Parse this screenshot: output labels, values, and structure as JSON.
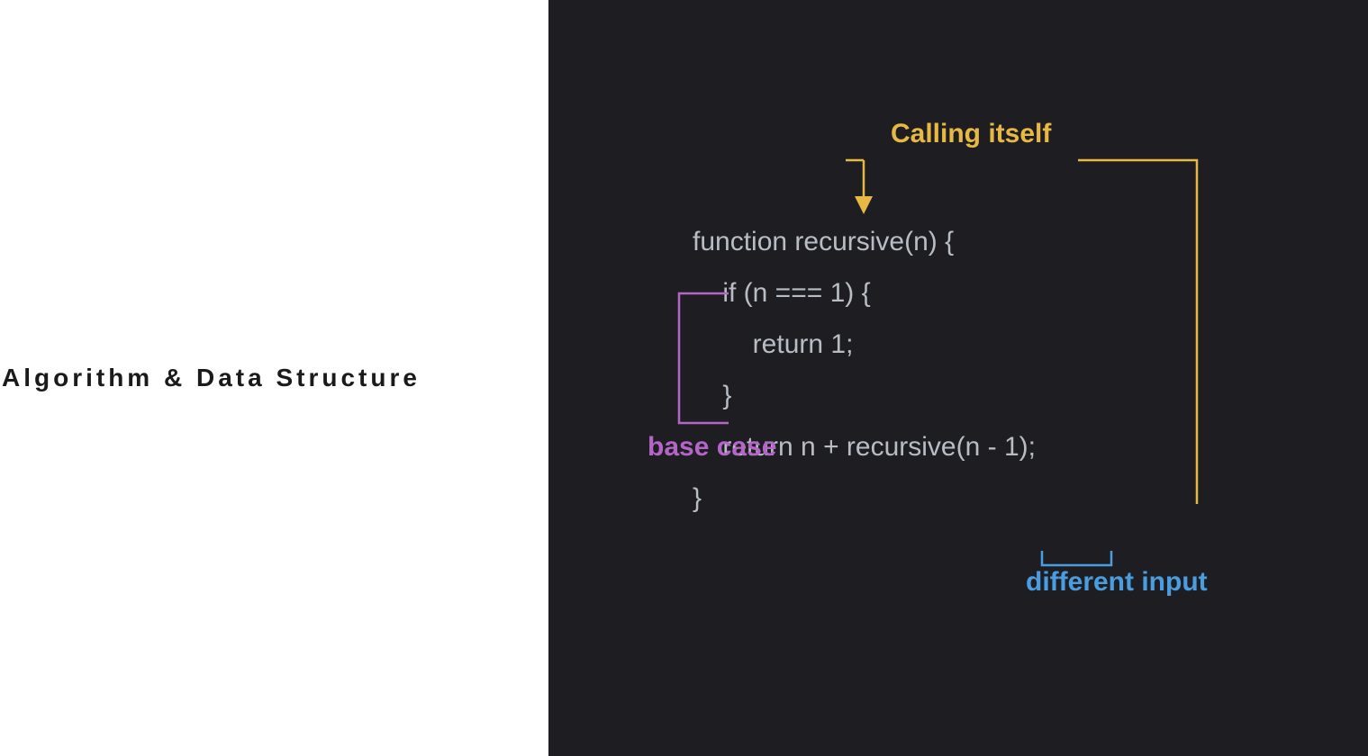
{
  "left": {
    "title": "Algorithm & Data Structure"
  },
  "annotations": {
    "calling_itself": "Calling itself",
    "base_case": "base case",
    "different_input": "different input"
  },
  "code": {
    "line1": "function recursive(n) {",
    "line2": "    if (n === 1) {",
    "line3": "        return 1;",
    "line4": "    }",
    "line5": "",
    "line6": "    return n + recursive(n - 1);",
    "line7": "}"
  },
  "colors": {
    "yellow": "#e8b844",
    "purple": "#b565c8",
    "blue": "#4a9de0",
    "code_bg": "#1e1e22",
    "code_text": "#b8bdc5"
  }
}
